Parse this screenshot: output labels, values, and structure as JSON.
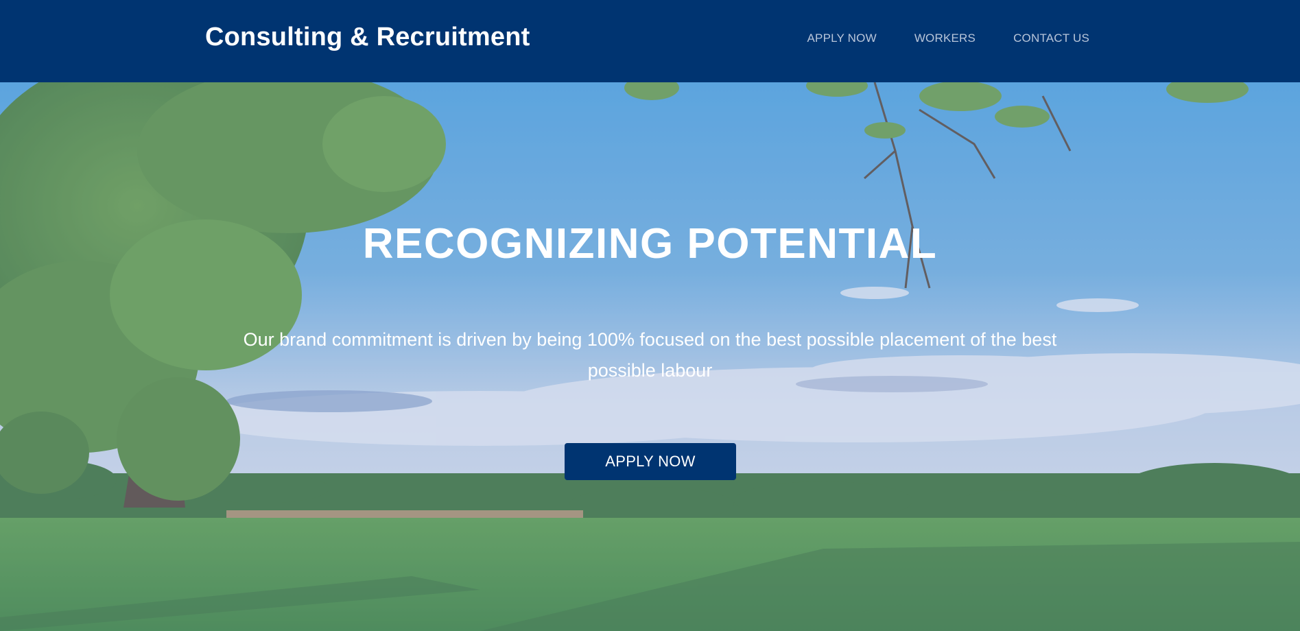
{
  "header": {
    "brand": "Consulting & Recruitment",
    "nav": [
      {
        "label": "APPLY NOW"
      },
      {
        "label": "WORKERS"
      },
      {
        "label": "CONTACT US"
      }
    ]
  },
  "hero": {
    "headline": "RECOGNIZING POTENTIAL",
    "tagline": "Our brand commitment is driven by being 100% focused on the best possible placement of the best possible labour",
    "cta_label": "APPLY NOW",
    "background_image": "countryside-field-with-trees-and-blue-sky"
  },
  "colors": {
    "header_bg": "#003471",
    "button_bg": "#003471",
    "nav_text": "#b9c6da",
    "hero_text": "#ffffff"
  }
}
